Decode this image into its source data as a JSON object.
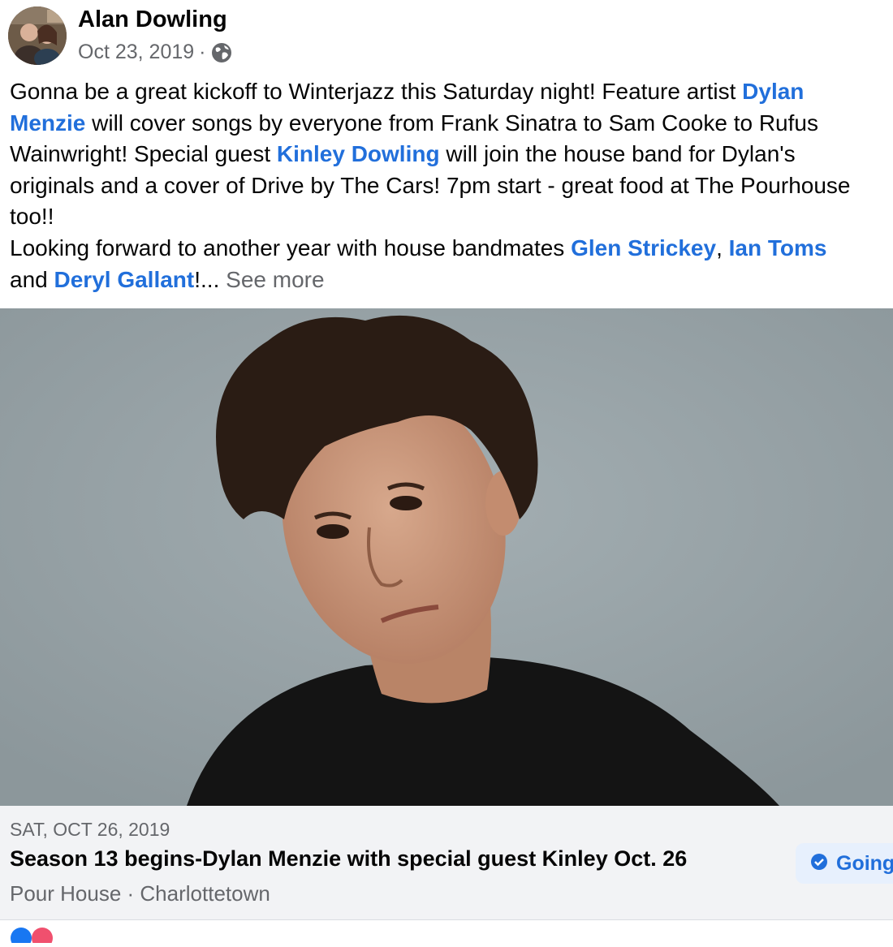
{
  "post": {
    "author": "Alan Dowling",
    "date": "Oct 23, 2019",
    "date_separator": "·",
    "privacy_icon": "globe-icon",
    "lines": [
      [
        {
          "text": "Gonna be a great kickoff to Winterjazz this Saturday night! Feature artist "
        },
        {
          "text": "Dylan",
          "link": true
        }
      ],
      [
        {
          "text": "Menzie",
          "link": true
        },
        {
          "text": " will cover songs by everyone from Frank Sinatra to Sam Cooke to Rufus"
        }
      ],
      [
        {
          "text": "Wainwright! Special guest "
        },
        {
          "text": "Kinley Dowling",
          "link": true
        },
        {
          "text": " will join the house band for Dylan's"
        }
      ],
      [
        {
          "text": "originals and a cover of Drive by The Cars! 7pm start - great food at The Pourhouse"
        }
      ],
      [
        {
          "text": "too!!"
        }
      ],
      [
        {
          "text": "Looking forward to another year with house bandmates "
        },
        {
          "text": "Glen Strickey",
          "link": true
        },
        {
          "text": ", "
        },
        {
          "text": "Ian Toms",
          "link": true
        }
      ],
      [
        {
          "text": "and "
        },
        {
          "text": "Deryl Gallant",
          "link": true
        },
        {
          "text": "!... "
        },
        {
          "text": "See more",
          "more": true
        }
      ]
    ]
  },
  "event": {
    "date": "SAT, OCT 26, 2019",
    "title": "Season 13 begins-Dylan Menzie with special guest Kinley Oct. 26",
    "place": "Pour House · Charlottetown",
    "going_label": "Going",
    "going_icon": "check-circle-icon"
  },
  "colors": {
    "link": "#216fdb",
    "secondary_text": "#65676b",
    "card_bg": "#f2f3f5"
  }
}
